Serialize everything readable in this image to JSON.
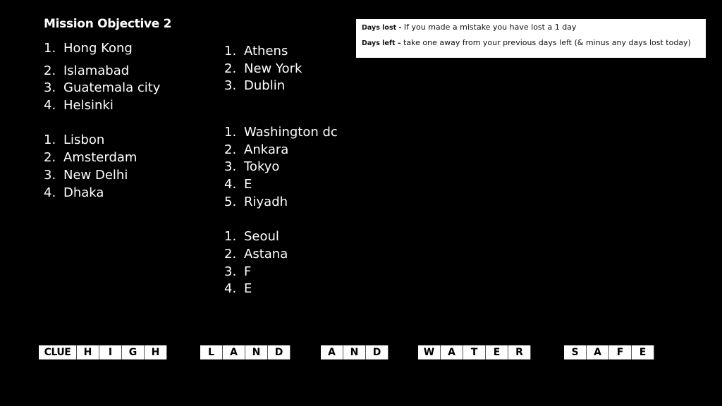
{
  "title": "Mission Objective 2",
  "left_lists": [
    {
      "items": [
        {
          "num": "1.",
          "text": "Hong Kong"
        },
        {
          "num": "2.",
          "text": "Islamabad"
        },
        {
          "num": "3.",
          "text": "Guatemala city"
        },
        {
          "num": "4.",
          "text": "Helsinki"
        }
      ]
    },
    {
      "items": [
        {
          "num": "1.",
          "text": "Lisbon"
        },
        {
          "num": "2.",
          "text": "Amsterdam"
        },
        {
          "num": "3.",
          "text": "New Delhi"
        },
        {
          "num": "4.",
          "text": "Dhaka"
        }
      ]
    }
  ],
  "right_lists": [
    {
      "items": [
        {
          "num": "1.",
          "text": "Athens"
        },
        {
          "num": "2.",
          "text": "New York"
        },
        {
          "num": "3.",
          "text": "Dublin"
        }
      ]
    },
    {
      "items": [
        {
          "num": "1.",
          "text": "Washington dc"
        },
        {
          "num": "2.",
          "text": "Ankara"
        },
        {
          "num": "3.",
          "text": "Tokyo"
        },
        {
          "num": "4.",
          "text": "E"
        },
        {
          "num": "5.",
          "text": "Riyadh"
        }
      ]
    },
    {
      "items": [
        {
          "num": "1.",
          "text": "Seoul"
        },
        {
          "num": "2.",
          "text": "Astana"
        },
        {
          "num": "3.",
          "text": "F"
        },
        {
          "num": "4.",
          "text": "E"
        }
      ]
    }
  ],
  "info": {
    "days_lost_label": "Days lost -",
    "days_lost_text": " If you made a mistake you have lost a 1 day",
    "days_left_label": "Days left –",
    "days_left_text": " take one away from your previous days left (& minus any days lost today)"
  },
  "clue": {
    "label": "CLUE",
    "words": [
      [
        "H",
        "I",
        "G",
        "H"
      ],
      [
        "L",
        "A",
        "N",
        "D"
      ],
      [
        "A",
        "N",
        "D"
      ],
      [
        "W",
        "A",
        "T",
        "E",
        "R"
      ],
      [
        "S",
        "A",
        "F",
        "E"
      ]
    ]
  }
}
